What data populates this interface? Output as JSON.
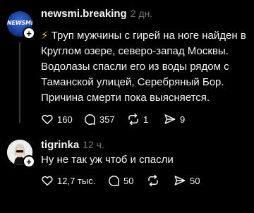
{
  "posts": [
    {
      "avatar_logo": "NEWSMI",
      "username": "newsmi.breaking",
      "time": "2 дн.",
      "text_icon": "⚡",
      "text": "Труп мужчины с гирей на ноге найден в Круглом озере, северо-запад Москвы. Водолазы спасли его из воды рядом с Таманской улицей, Серебряный Бор. Причина смерти пока выясняется.",
      "likes": "160",
      "comments": "357",
      "reposts": "1",
      "shares": "9"
    },
    {
      "username": "tigrinka",
      "time": "12 ч.",
      "text": "Ну не так уж чтоб и спасли",
      "likes": "12,7 тыс.",
      "comments": "50",
      "reposts": "",
      "shares": "50"
    }
  ],
  "icons": {
    "like": "heart-icon",
    "comment": "comment-bubble-icon",
    "repost": "repost-icon",
    "share": "send-icon"
  }
}
